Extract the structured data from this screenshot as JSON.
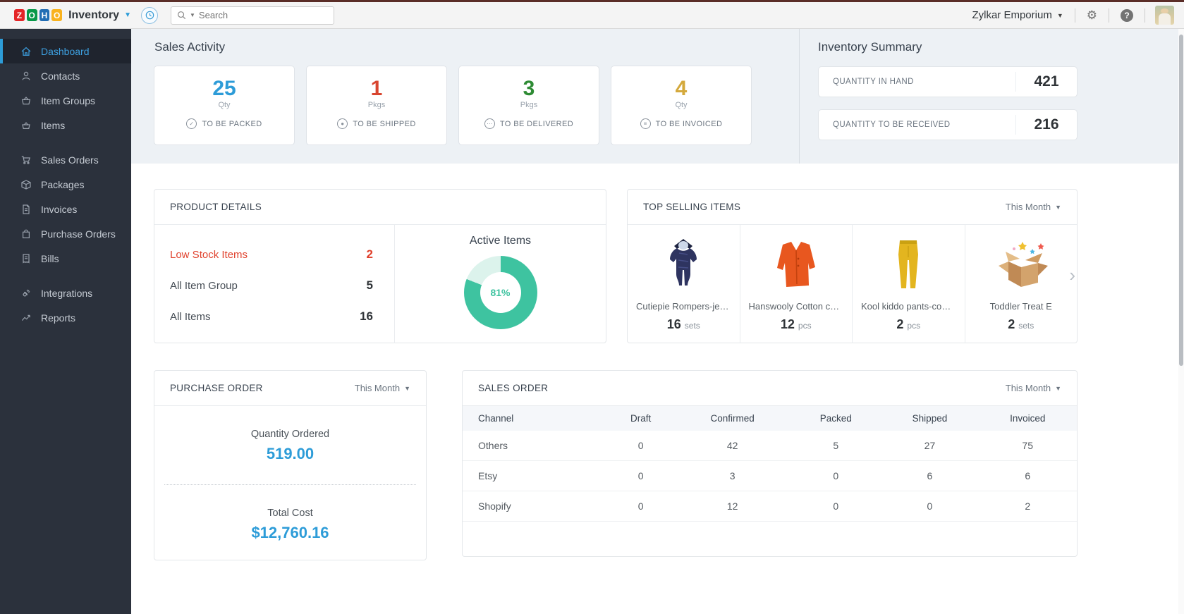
{
  "topbar": {
    "logo_letters": [
      "Z",
      "O",
      "H",
      "O"
    ],
    "logo_colors": [
      "#E42527",
      "#089949",
      "#226DB4",
      "#F9B21D"
    ],
    "product": "Inventory",
    "search_placeholder": "Search",
    "org_name": "Zylkar Emporium",
    "icons": [
      "history-icon",
      "search-icon",
      "gear-icon",
      "help-icon",
      "avatar"
    ]
  },
  "sidebar": {
    "items": [
      {
        "label": "Dashboard",
        "icon": "home-icon",
        "active": true
      },
      {
        "label": "Contacts",
        "icon": "person-icon"
      },
      {
        "label": "Item Groups",
        "icon": "basket-icon"
      },
      {
        "label": "Items",
        "icon": "basket-icon"
      },
      {
        "label": "Sales Orders",
        "icon": "cart-icon"
      },
      {
        "label": "Packages",
        "icon": "package-icon"
      },
      {
        "label": "Invoices",
        "icon": "document-icon"
      },
      {
        "label": "Purchase Orders",
        "icon": "bag-icon"
      },
      {
        "label": "Bills",
        "icon": "receipt-icon"
      },
      {
        "label": "Integrations",
        "icon": "plug-icon"
      },
      {
        "label": "Reports",
        "icon": "graph-icon"
      }
    ]
  },
  "sales_activity": {
    "title": "Sales Activity",
    "cards": [
      {
        "value": "25",
        "unit": "Qty",
        "label": "TO BE PACKED",
        "color": "#2d9cd8",
        "icon": "check-circle-icon"
      },
      {
        "value": "1",
        "unit": "Pkgs",
        "label": "TO BE SHIPPED",
        "color": "#d8452f",
        "icon": "shipped-circle-icon"
      },
      {
        "value": "3",
        "unit": "Pkgs",
        "label": "TO BE DELIVERED",
        "color": "#2e8b34",
        "icon": "delivered-circle-icon"
      },
      {
        "value": "4",
        "unit": "Qty",
        "label": "TO BE INVOICED",
        "color": "#d4a93c",
        "icon": "invoice-circle-icon"
      }
    ]
  },
  "inventory_summary": {
    "title": "Inventory Summary",
    "rows": [
      {
        "label": "QUANTITY IN HAND",
        "value": "421"
      },
      {
        "label": "QUANTITY TO BE RECEIVED",
        "value": "216"
      }
    ]
  },
  "product_details": {
    "title": "PRODUCT DETAILS",
    "rows": [
      {
        "label": "Low Stock Items",
        "value": "2",
        "alert": true
      },
      {
        "label": "All Item Group",
        "value": "5"
      },
      {
        "label": "All Items",
        "value": "16"
      }
    ],
    "chart": {
      "type": "pie",
      "label": "Active Items",
      "percent": 81,
      "percent_label": "81%",
      "color": "#3ec3a0",
      "track_color": "#dcf3ec"
    }
  },
  "top_selling": {
    "title": "TOP SELLING ITEMS",
    "period": "This Month",
    "items": [
      {
        "name": "Cutiepie Rompers-jet ...",
        "qty": "16",
        "unit": "sets",
        "image": "navy-romper"
      },
      {
        "name": "Hanswooly Cotton cas...",
        "qty": "12",
        "unit": "pcs",
        "image": "orange-cardigan"
      },
      {
        "name": "Kool kiddo pants-cow ...",
        "qty": "2",
        "unit": "pcs",
        "image": "yellow-pants"
      },
      {
        "name": "Toddler Treat E",
        "qty": "2",
        "unit": "sets",
        "image": "gift-box"
      }
    ]
  },
  "purchase_order": {
    "title": "PURCHASE ORDER",
    "period": "This Month",
    "metrics": [
      {
        "label": "Quantity Ordered",
        "value": "519.00"
      },
      {
        "label": "Total Cost",
        "value": "$12,760.16"
      }
    ]
  },
  "sales_order": {
    "title": "SALES ORDER",
    "period": "This Month",
    "columns": [
      "Channel",
      "Draft",
      "Confirmed",
      "Packed",
      "Shipped",
      "Invoiced"
    ],
    "rows": [
      [
        "Others",
        "0",
        "42",
        "5",
        "27",
        "75"
      ],
      [
        "Etsy",
        "0",
        "3",
        "0",
        "6",
        "6"
      ],
      [
        "Shopify",
        "0",
        "12",
        "0",
        "0",
        "2"
      ]
    ]
  }
}
